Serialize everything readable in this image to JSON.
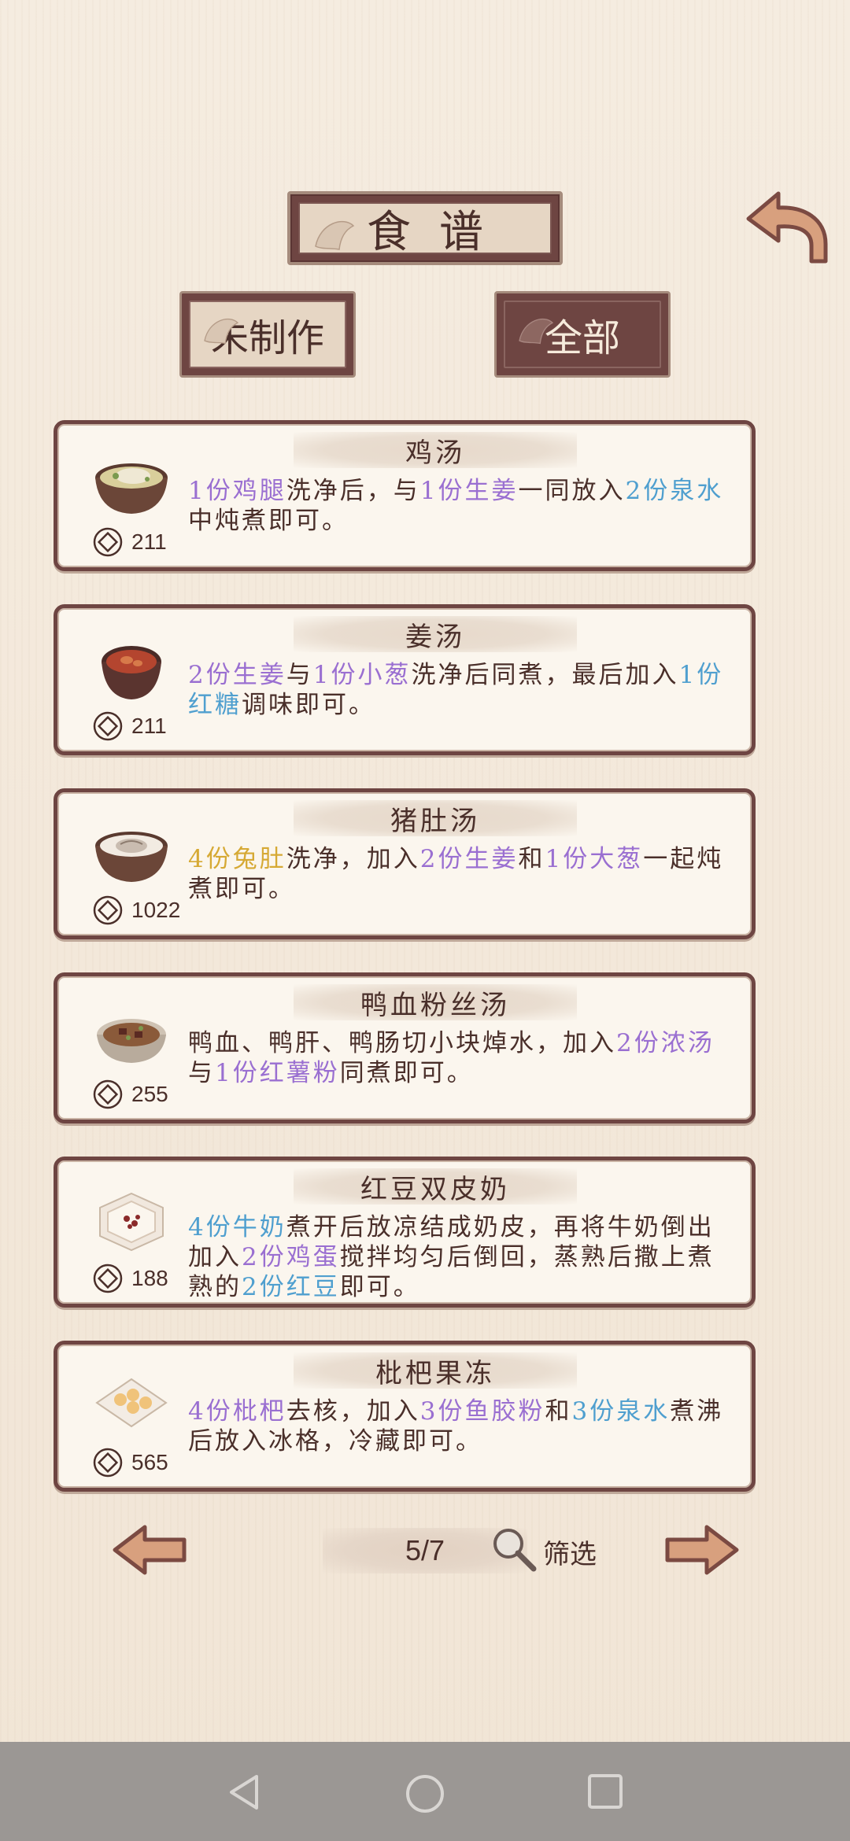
{
  "header": {
    "title": "食谱"
  },
  "filters": {
    "unmade": "未制作",
    "all": "全部"
  },
  "recipes": [
    {
      "name": "鸡汤",
      "price": "211",
      "icon": "chicken-soup-icon",
      "desc": [
        {
          "t": "1份鸡腿",
          "c": "purple"
        },
        {
          "t": "洗净后，与",
          "c": ""
        },
        {
          "t": "1份生姜",
          "c": "purple"
        },
        {
          "t": "一同放入",
          "c": ""
        },
        {
          "t": "2份泉水",
          "c": "blue"
        },
        {
          "t": "中炖煮即可。",
          "c": ""
        }
      ]
    },
    {
      "name": "姜汤",
      "price": "211",
      "icon": "ginger-soup-icon",
      "desc": [
        {
          "t": "2份生姜",
          "c": "purple"
        },
        {
          "t": "与",
          "c": ""
        },
        {
          "t": "1份小葱",
          "c": "purple"
        },
        {
          "t": "洗净后同煮，最后加入",
          "c": ""
        },
        {
          "t": "1份红糖",
          "c": "blue"
        },
        {
          "t": "调味即可。",
          "c": ""
        }
      ]
    },
    {
      "name": "猪肚汤",
      "price": "1022",
      "icon": "pork-tripe-soup-icon",
      "desc": [
        {
          "t": "4份兔肚",
          "c": "gold"
        },
        {
          "t": "洗净，加入",
          "c": ""
        },
        {
          "t": "2份生姜",
          "c": "purple"
        },
        {
          "t": "和",
          "c": ""
        },
        {
          "t": "1份大葱",
          "c": "purple"
        },
        {
          "t": "一起炖煮即可。",
          "c": ""
        }
      ]
    },
    {
      "name": "鸭血粉丝汤",
      "price": "255",
      "icon": "duck-blood-soup-icon",
      "desc": [
        {
          "t": "鸭血、鸭肝、鸭肠切小块焯水，加入",
          "c": ""
        },
        {
          "t": "2份浓汤",
          "c": "purple"
        },
        {
          "t": "与",
          "c": ""
        },
        {
          "t": "1份红薯粉",
          "c": "purple"
        },
        {
          "t": "同煮即可。",
          "c": ""
        }
      ]
    },
    {
      "name": "红豆双皮奶",
      "price": "188",
      "icon": "red-bean-pudding-icon",
      "desc": [
        {
          "t": "4份牛奶",
          "c": "blue"
        },
        {
          "t": "煮开后放凉结成奶皮，再将牛奶倒出加入",
          "c": ""
        },
        {
          "t": "2份鸡蛋",
          "c": "purple"
        },
        {
          "t": "搅拌均匀后倒回，蒸熟后撒上煮熟的",
          "c": ""
        },
        {
          "t": "2份红豆",
          "c": "blue"
        },
        {
          "t": "即可。",
          "c": ""
        }
      ]
    },
    {
      "name": "枇杷果冻",
      "price": "565",
      "icon": "loquat-jelly-icon",
      "desc": [
        {
          "t": "4份枇杷",
          "c": "purple"
        },
        {
          "t": "去核，加入",
          "c": ""
        },
        {
          "t": "3份鱼胶粉",
          "c": "purple"
        },
        {
          "t": "和",
          "c": ""
        },
        {
          "t": "3份泉水",
          "c": "blue"
        },
        {
          "t": "煮沸后放入冰格，冷藏即可。",
          "c": ""
        }
      ]
    }
  ],
  "pagination": {
    "page": "5/7",
    "filter_label": "筛选"
  },
  "colors": {
    "frame": "#6e4542",
    "plate": "#e6d6c4",
    "highlight_purple": "#9a6fd1",
    "highlight_blue": "#4f9fcf",
    "highlight_gold": "#d6a934"
  }
}
